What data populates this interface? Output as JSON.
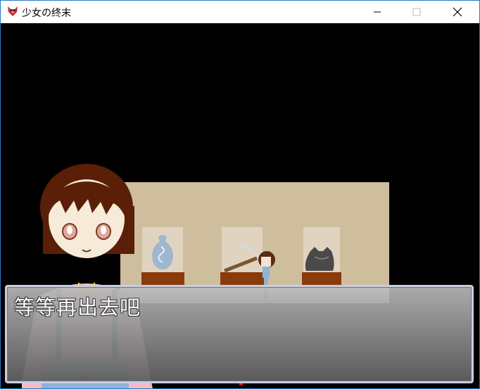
{
  "window": {
    "title": "少女の终末",
    "icon": "game-red-fox-icon"
  },
  "controls": {
    "minimize": "minimize-icon",
    "maximize": "maximize-icon",
    "close": "close-icon"
  },
  "dialogue": {
    "text": "等等再出去吧"
  },
  "colors": {
    "wall": "#cfbe9e",
    "pedestal": "#8b3b0a",
    "floor": "#e8e8e8",
    "message_border": "#c9cede"
  }
}
